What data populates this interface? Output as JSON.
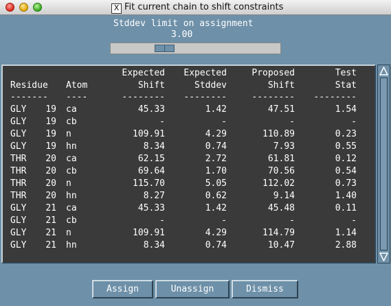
{
  "window": {
    "title": "Fit current chain to shift constraints",
    "close_glyph": "X"
  },
  "slider": {
    "label": "Stddev limit on assignment",
    "value": "3.00"
  },
  "table": {
    "header_line1": [
      "",
      "",
      "Expected",
      "Expected",
      "Proposed",
      "Test"
    ],
    "header_line2": [
      "Residue",
      "Atom",
      "Shift",
      "Stddev",
      "Shift",
      "Stat"
    ],
    "separators": [
      "-------",
      "----",
      "--------",
      "--------",
      "--------",
      "--------"
    ],
    "rows": [
      [
        "GLY",
        "19",
        "ca",
        "45.33",
        "1.42",
        "47.51",
        "1.54"
      ],
      [
        "GLY",
        "19",
        "cb",
        "-",
        "-",
        "-",
        "-"
      ],
      [
        "GLY",
        "19",
        "n",
        "109.91",
        "4.29",
        "110.89",
        "0.23"
      ],
      [
        "GLY",
        "19",
        "hn",
        "8.34",
        "0.74",
        "7.93",
        "0.55"
      ],
      [
        "THR",
        "20",
        "ca",
        "62.15",
        "2.72",
        "61.81",
        "0.12"
      ],
      [
        "THR",
        "20",
        "cb",
        "69.64",
        "1.70",
        "70.56",
        "0.54"
      ],
      [
        "THR",
        "20",
        "n",
        "115.70",
        "5.05",
        "112.02",
        "0.73"
      ],
      [
        "THR",
        "20",
        "hn",
        "8.27",
        "0.62",
        "9.14",
        "1.40"
      ],
      [
        "GLY",
        "21",
        "ca",
        "45.33",
        "1.42",
        "45.48",
        "0.11"
      ],
      [
        "GLY",
        "21",
        "cb",
        "-",
        "-",
        "-",
        "-"
      ],
      [
        "GLY",
        "21",
        "n",
        "109.91",
        "4.29",
        "114.79",
        "1.14"
      ],
      [
        "GLY",
        "21",
        "hn",
        "8.34",
        "0.74",
        "10.47",
        "2.88"
      ]
    ]
  },
  "buttons": {
    "assign": "Assign",
    "unassign": "Unassign",
    "dismiss": "Dismiss"
  },
  "colors": {
    "background": "#6e90a8",
    "list_background": "#3a3a3a",
    "text": "#ffffff"
  },
  "icons": {
    "scroll_up": "triangle-up-icon",
    "scroll_down": "triangle-down-icon"
  }
}
